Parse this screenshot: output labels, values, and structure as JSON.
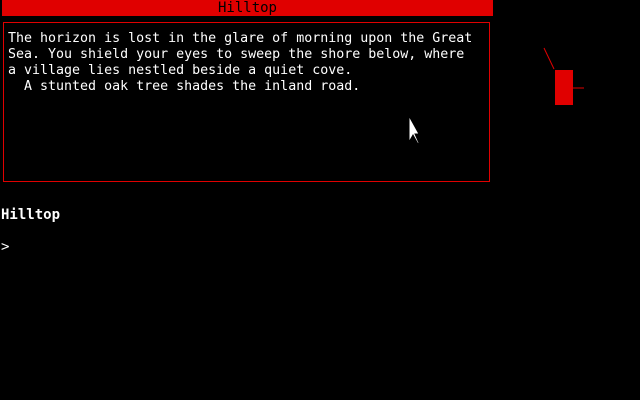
{
  "window": {
    "title": "Hilltop"
  },
  "room": {
    "description_lines": [
      "The horizon is lost in the glare of morning upon the Great",
      "Sea. You shield your eyes to sweep the shore below, where",
      "a village lies nestled beside a quiet cove.",
      "  A stunted oak tree shades the inland road."
    ]
  },
  "status": {
    "location": "Hilltop"
  },
  "input": {
    "prompt": ">",
    "value": ""
  },
  "icons": {
    "compass": "compass-rose-icon",
    "cursor": "mouse-pointer-icon"
  },
  "colors": {
    "background": "#000000",
    "accent": "#e00000",
    "text": "#ffffff",
    "title_text": "#000000"
  }
}
